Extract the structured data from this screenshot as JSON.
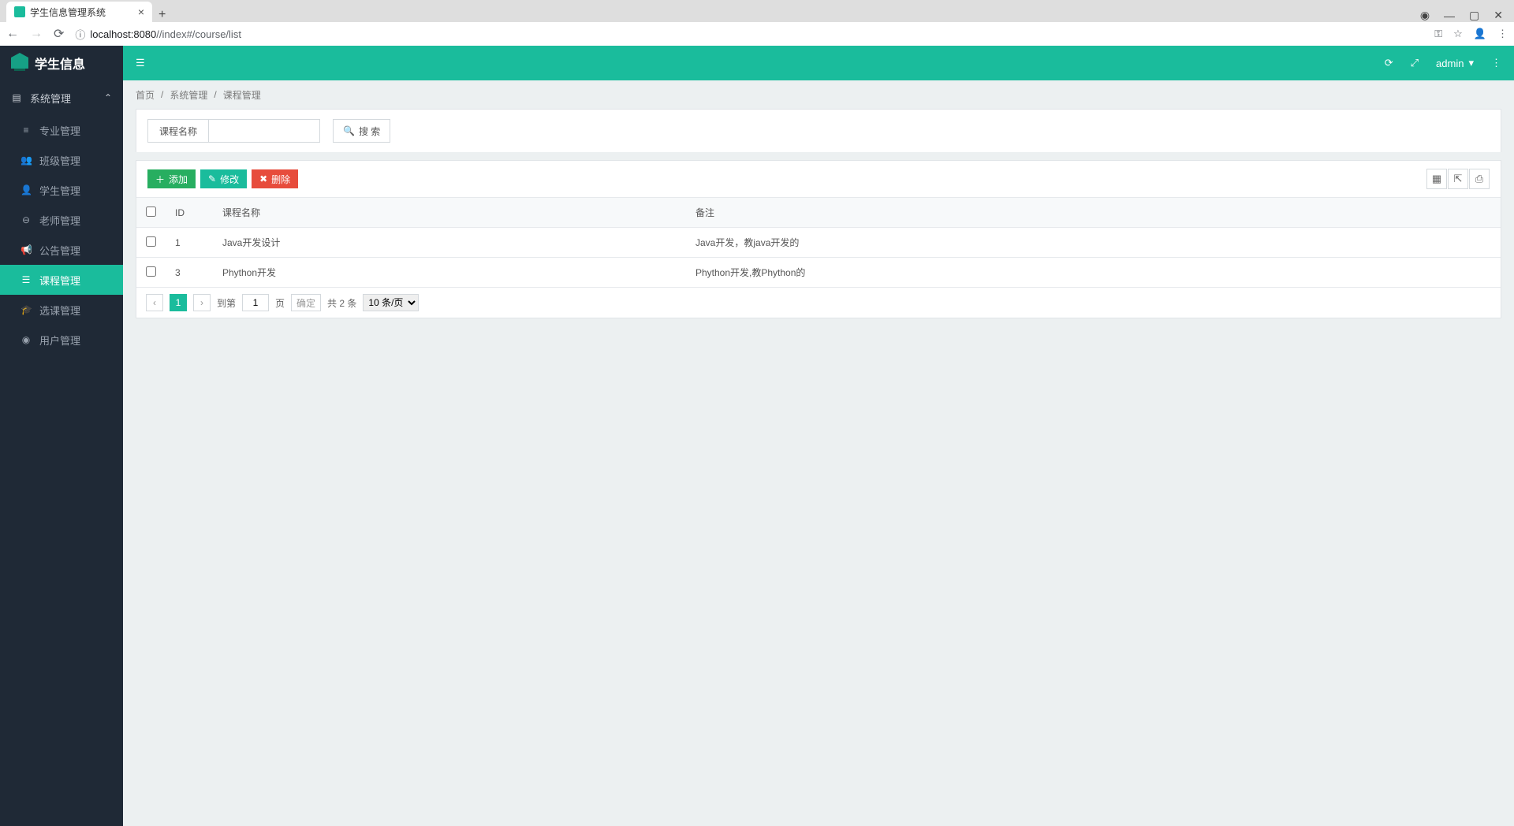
{
  "browser": {
    "tab_title": "学生信息管理系统",
    "url_host": "localhost:8080",
    "url_path": "//index#/course/list"
  },
  "logo": {
    "text": "学生信息"
  },
  "sidebar": {
    "group": "系统管理",
    "items": [
      {
        "label": "专业管理",
        "icon": "≡"
      },
      {
        "label": "班级管理",
        "icon": "👥"
      },
      {
        "label": "学生管理",
        "icon": "👤"
      },
      {
        "label": "老师管理",
        "icon": "⊖"
      },
      {
        "label": "公告管理",
        "icon": "📢"
      },
      {
        "label": "课程管理",
        "icon": "☰",
        "active": true
      },
      {
        "label": "选课管理",
        "icon": "🎓"
      },
      {
        "label": "用户管理",
        "icon": "◉"
      }
    ]
  },
  "topbar": {
    "user": "admin"
  },
  "breadcrumb": {
    "home": "首页",
    "l1": "系统管理",
    "l2": "课程管理"
  },
  "search": {
    "label": "课程名称",
    "button": "搜 索"
  },
  "toolbar": {
    "add": "添加",
    "edit": "修改",
    "del": "删除"
  },
  "table": {
    "headers": {
      "id": "ID",
      "name": "课程名称",
      "remark": "备注"
    },
    "rows": [
      {
        "id": "1",
        "name": "Java开发设计",
        "remark": "Java开发，教java开发的"
      },
      {
        "id": "3",
        "name": "Phython开发",
        "remark": "Phython开发,教Phython的"
      }
    ]
  },
  "pager": {
    "current": "1",
    "goto_pre": "到第",
    "goto_val": "1",
    "goto_post": "页",
    "confirm": "确定",
    "total": "共 2 条",
    "size": "10 条/页"
  }
}
